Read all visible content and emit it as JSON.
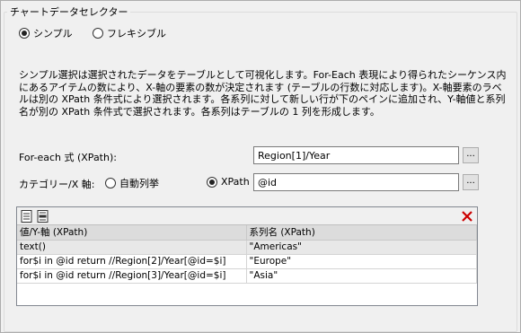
{
  "group": {
    "title": "チャートデータセレクター"
  },
  "mode": {
    "simple_label": "シンプル",
    "flexible_label": "フレキシブル",
    "selected": "simple"
  },
  "description": "シンプル選択は選択されたデータをテーブルとして可視化します。For-Each 表現により得られたシーケンス内にあるアイテムの数により、X-軸の要素の数が決定されます (テーブルの行数に対応します)。X-軸要素のラベルは別の XPath 条件式により選択されます。各系列に対して新しい行が下のペインに追加され、Y-軸値と系列名が別の XPath 条件式で選択されます。各系列はテーブルの 1 列を形成します。",
  "foreach": {
    "label": "For-each 式 (XPath):",
    "value": "Region[1]/Year",
    "browse_label": "..."
  },
  "category": {
    "label": "カテゴリー/X 軸:",
    "auto_label": "自動列挙",
    "xpath_label": "XPath",
    "selected": "xpath",
    "value": "@id",
    "browse_label": "..."
  },
  "grid": {
    "toolbar": {
      "append_icon": "append-row-icon",
      "insert_icon": "insert-row-icon",
      "delete_icon": "delete-x-icon",
      "delete_color": "#cc0000"
    },
    "columns": [
      "値/Y-軸 (XPath)",
      "系列名 (XPath)"
    ],
    "rows": [
      [
        "text()",
        "\"Americas\""
      ],
      [
        "for$i in @id return //Region[2]/Year[@id=$i]",
        "\"Europe\""
      ],
      [
        "for$i in @id return //Region[3]/Year[@id=$i]",
        "\"Asia\""
      ]
    ]
  }
}
